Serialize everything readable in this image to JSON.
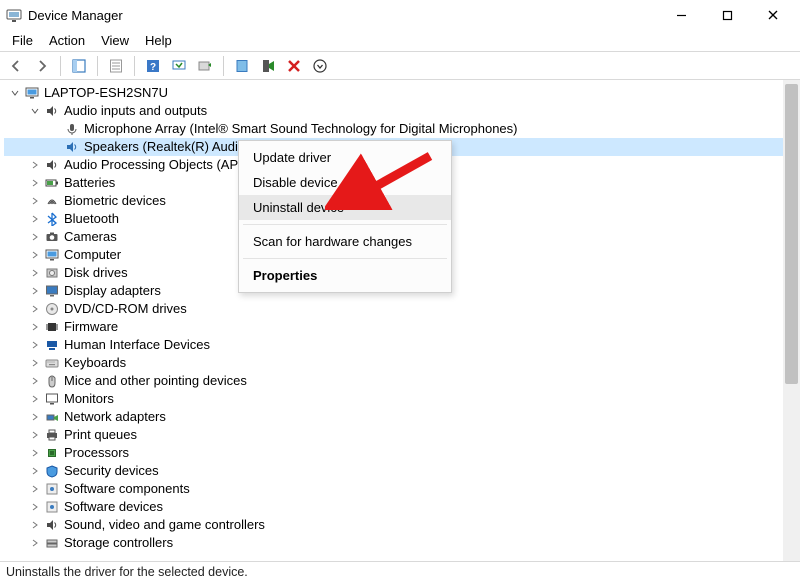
{
  "window": {
    "title": "Device Manager"
  },
  "menu": {
    "file": "File",
    "action": "Action",
    "view": "View",
    "help": "Help"
  },
  "tree": {
    "root": "LAPTOP-ESH2SN7U",
    "audio_category": "Audio inputs and outputs",
    "audio_child1": "Microphone Array (Intel® Smart Sound Technology for Digital Microphones)",
    "audio_child2": "Speakers (Realtek(R) Audi",
    "categories": [
      "Audio Processing Objects (AP",
      "Batteries",
      "Biometric devices",
      "Bluetooth",
      "Cameras",
      "Computer",
      "Disk drives",
      "Display adapters",
      "DVD/CD-ROM drives",
      "Firmware",
      "Human Interface Devices",
      "Keyboards",
      "Mice and other pointing devices",
      "Monitors",
      "Network adapters",
      "Print queues",
      "Processors",
      "Security devices",
      "Software components",
      "Software devices",
      "Sound, video and game controllers",
      "Storage controllers"
    ]
  },
  "context_menu": {
    "update": "Update driver",
    "disable": "Disable device",
    "uninstall": "Uninstall device",
    "scan": "Scan for hardware changes",
    "properties": "Properties"
  },
  "status": {
    "text": "Uninstalls the driver for the selected device."
  }
}
